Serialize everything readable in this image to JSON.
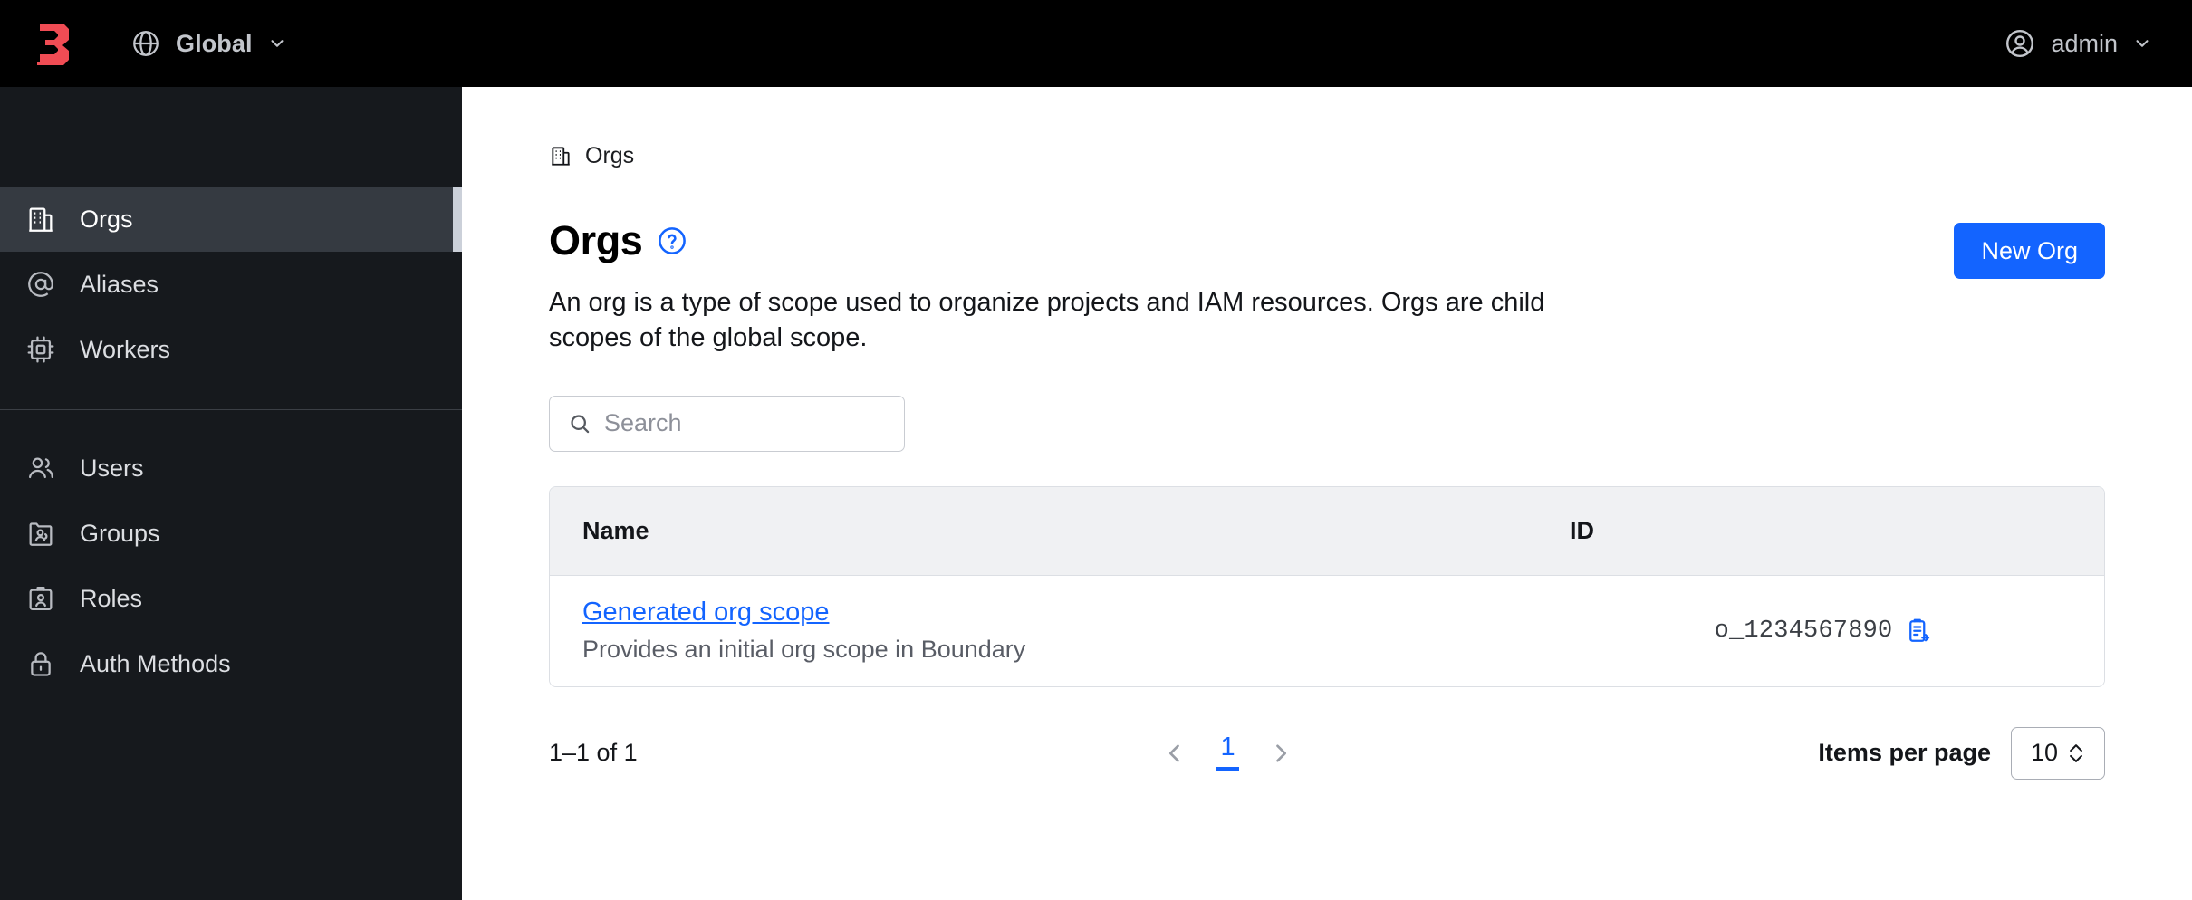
{
  "topbar": {
    "logo_name": "boundary-logo",
    "scope": {
      "label": "Global",
      "icon": "globe-icon",
      "chevron": "chevron-down-icon"
    },
    "user": {
      "label": "admin",
      "icon": "user-circle-icon",
      "chevron": "chevron-down-icon"
    },
    "background": "#000000"
  },
  "sidebar": {
    "background": "#16191d",
    "active_background": "#353a41",
    "groups": [
      {
        "items": [
          {
            "label": "Orgs",
            "icon": "building-icon",
            "active": true
          },
          {
            "label": "Aliases",
            "icon": "at-sign-icon",
            "active": false
          },
          {
            "label": "Workers",
            "icon": "cpu-icon",
            "active": false
          }
        ]
      },
      {
        "items": [
          {
            "label": "Users",
            "icon": "users-icon",
            "active": false
          },
          {
            "label": "Groups",
            "icon": "folder-users-icon",
            "active": false
          },
          {
            "label": "Roles",
            "icon": "id-badge-icon",
            "active": false
          },
          {
            "label": "Auth Methods",
            "icon": "lock-icon",
            "active": false
          }
        ]
      }
    ]
  },
  "main": {
    "breadcrumb": {
      "icon": "building-icon",
      "text": "Orgs"
    },
    "title": "Orgs",
    "help_icon": "help-circle-icon",
    "description": "An org is a type of scope used to organize projects and IAM resources. Orgs are child scopes of the global scope.",
    "new_button": {
      "label": "New Org",
      "color": "#1364ff"
    },
    "search": {
      "placeholder": "Search",
      "value": "",
      "icon": "search-icon"
    },
    "table": {
      "columns": [
        "Name",
        "ID"
      ],
      "rows": [
        {
          "name": "Generated org scope",
          "description": "Provides an initial org scope in Boundary",
          "id": "o_1234567890",
          "copy_icon": "copy-clipboard-icon"
        }
      ]
    },
    "pagination": {
      "summary": "1–1 of 1",
      "prev_icon": "chevron-left-icon",
      "next_icon": "chevron-right-icon",
      "current_page": "1",
      "items_per_page_label": "Items per page",
      "items_per_page_value": "10",
      "stepper_icon": "chevron-updown-icon"
    }
  }
}
